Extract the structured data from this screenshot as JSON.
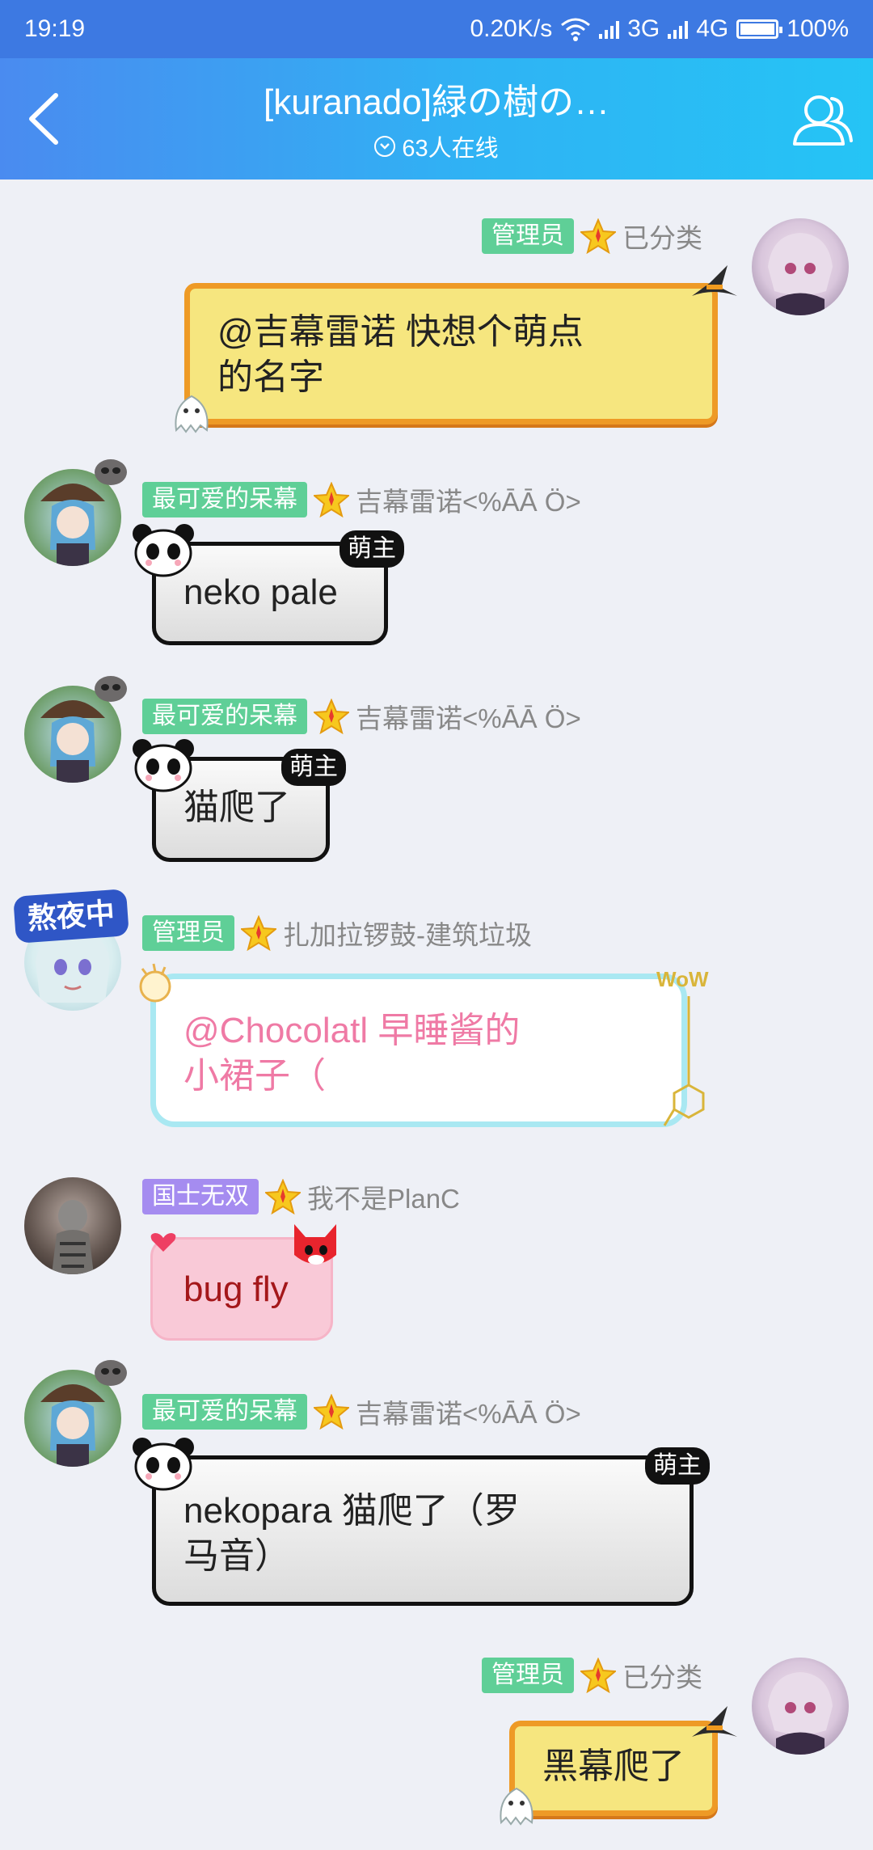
{
  "status_bar": {
    "time": "19:19",
    "speed": "0.20K/s",
    "network1": "3G",
    "network2": "4G",
    "battery": "100%"
  },
  "header": {
    "title": "[kuranado]緑の樹の…",
    "online": "63人在线"
  },
  "messages": [
    {
      "side": "right",
      "badge": "管理员",
      "badge_color": "#5fcf97",
      "name": "已分类",
      "text_line1": "@吉幕雷诺 快想个萌点",
      "text_line2": "的名字",
      "bubble": "orange"
    },
    {
      "side": "left",
      "badge": "最可爱的呆幕",
      "badge_color": "#5fcf97",
      "name": "吉幕雷诺<%ĀĀ Ö>",
      "text_line1": "neko pale",
      "bubble": "panda",
      "tag": "萌主"
    },
    {
      "side": "left",
      "badge": "最可爱的呆幕",
      "badge_color": "#5fcf97",
      "name": "吉幕雷诺<%ĀĀ Ö>",
      "text_line1": "猫爬了",
      "bubble": "panda",
      "tag": "萌主"
    },
    {
      "side": "left",
      "badge": "管理员",
      "badge_color": "#5fcf97",
      "name": "扎加拉锣鼓-建筑垃圾",
      "text_line1": "@Chocolatl 早睡酱的",
      "text_line2": "小裙子（",
      "bubble": "cyan",
      "avatar_tag": "熬夜中",
      "wow": "WoW"
    },
    {
      "side": "left",
      "badge": "国士无双",
      "badge_color": "#a58cf0",
      "name": "我不是PlanC",
      "text_line1": "bug fly",
      "bubble": "pink"
    },
    {
      "side": "left",
      "badge": "最可爱的呆幕",
      "badge_color": "#5fcf97",
      "name": "吉幕雷诺<%ĀĀ Ö>",
      "text_line1": "nekopara 猫爬了（罗",
      "text_line2": "马音）",
      "bubble": "panda",
      "tag": "萌主"
    },
    {
      "side": "right",
      "badge": "管理员",
      "badge_color": "#5fcf97",
      "name": "已分类",
      "text_line1": "黑幕爬了",
      "bubble": "orange"
    }
  ]
}
